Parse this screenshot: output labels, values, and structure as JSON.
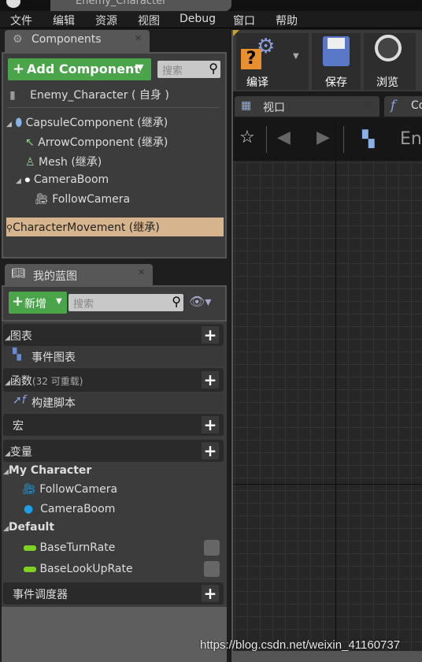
{
  "window": {
    "title": "Enemy_Character"
  },
  "menu": [
    "文件",
    "编辑",
    "资源",
    "视图",
    "Debug",
    "窗口",
    "帮助"
  ],
  "components": {
    "tab": "Components",
    "add_button": "Add Component",
    "search_placeholder": "搜索",
    "root": "Enemy_Character ( 自身 )",
    "items": [
      {
        "label": "CapsuleComponent (继承)",
        "icon": "capsule-icon"
      },
      {
        "label": "ArrowComponent (继承)",
        "icon": "arrow-icon"
      },
      {
        "label": "Mesh (继承)",
        "icon": "mesh-icon"
      },
      {
        "label": "CameraBoom",
        "icon": "spring-arm-icon"
      },
      {
        "label": "FollowCamera",
        "icon": "camera-icon"
      },
      {
        "label": "CharacterMovement (继承)",
        "icon": "movement-icon",
        "selected": true
      }
    ]
  },
  "blueprint": {
    "tab": "我的蓝图",
    "add_button": "新增",
    "search_placeholder": "搜索",
    "graphs": {
      "title": "图表",
      "items": [
        "事件图表"
      ]
    },
    "functions": {
      "title": "函数",
      "note": "(32 可重载)",
      "items": [
        "构建脚本"
      ]
    },
    "macros": {
      "title": "宏"
    },
    "variables": {
      "title": "变量",
      "categories": [
        {
          "name": "My Character",
          "items": [
            "FollowCamera",
            "CameraBoom"
          ]
        },
        {
          "name": "Default",
          "items": [
            "BaseTurnRate",
            "BaseLookUpRate"
          ]
        }
      ]
    },
    "dispatchers": {
      "title": "事件调度器"
    }
  },
  "toolbar": {
    "compile": "编译",
    "save": "保存",
    "browse": "浏览"
  },
  "editor_tabs": {
    "viewport": "视口",
    "construction": "Co"
  },
  "graph_header": {
    "title": "En"
  },
  "watermark": "https://blog.csdn.net/weixin_41160737",
  "colors": {
    "green": "#4aa54a",
    "selected_row": "#d6b48e",
    "float_var": "#7ed321"
  }
}
